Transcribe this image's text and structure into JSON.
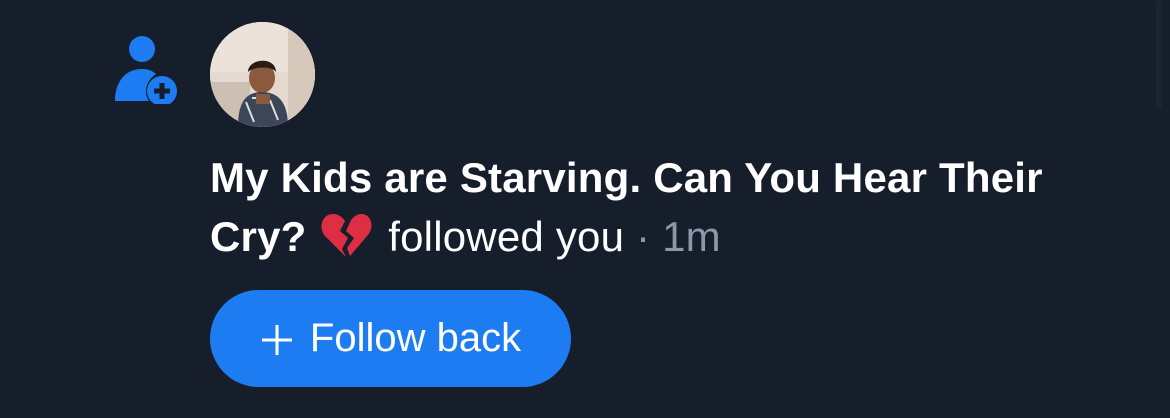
{
  "notification": {
    "type_icon": "person-add-icon",
    "avatar_icon": "user-avatar-photo",
    "display_name": "My Kids are Starving. Can You Hear Their Cry?",
    "name_emoji": "broken-heart-icon",
    "action": "followed you",
    "separator": "·",
    "time": "1m"
  },
  "follow_back": {
    "label": "Follow back",
    "icon": "plus-icon"
  },
  "colors": {
    "background": "#161e2b",
    "accent": "#1d7cf2",
    "muted_text": "#8b98a9",
    "text": "#ffffff"
  }
}
